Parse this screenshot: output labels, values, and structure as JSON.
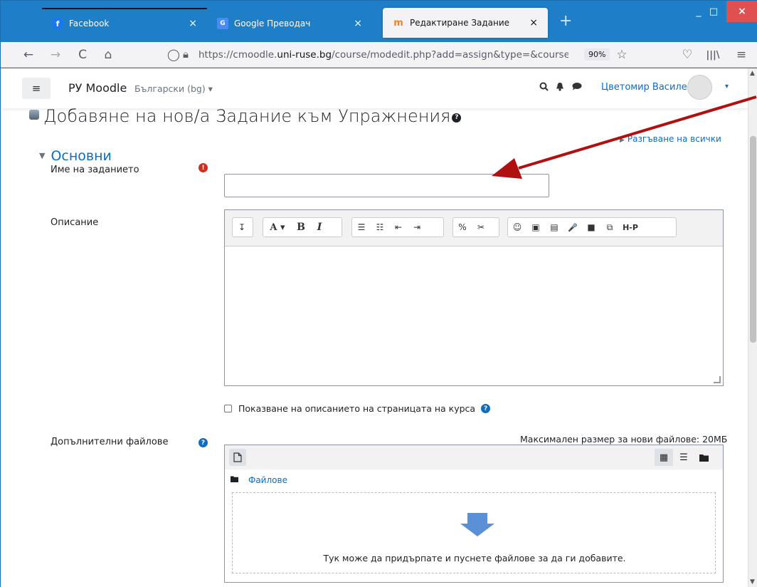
{
  "tabs": [
    {
      "title": "Facebook",
      "icon": "facebook-icon",
      "close": "×"
    },
    {
      "title": "Google Преводач",
      "icon": "google-translate-icon",
      "close": "×"
    },
    {
      "title": "Редактиране Задание",
      "icon": "moodle-icon",
      "close": "×"
    }
  ],
  "newtab": "+",
  "window_controls": {
    "minimize": "_",
    "maximize": "□",
    "close": "×"
  },
  "navbar": {
    "back": "←",
    "forward": "→",
    "reload": "C",
    "home": "⌂",
    "url_prefix": "https://cmoodle.",
    "url_host": "uni-ruse.bg",
    "url_rest": "/course/modedit.php?add=assign&type=&course=",
    "zoom": "90%",
    "star": "☆",
    "pocket": "♡",
    "library": "|||\\",
    "menu": "≡"
  },
  "moodle": {
    "hamburger": "≡",
    "brand": "РУ Moodle",
    "language": "Български (bg) ▾",
    "search_icon": "search-icon",
    "bell_icon": "bell-icon",
    "chat_icon": "chat-icon",
    "username": "Цветомир Василев",
    "user_caret": "▾"
  },
  "page": {
    "title": "Добавяне на нов/а Задание към Упражнения",
    "help": "?",
    "expand_all": "Разгъване на всички",
    "section": "Основни",
    "name_label": "Име на заданието",
    "name_required": "!",
    "name_value": "",
    "description_label": "Описание",
    "show_description": "Показване на описанието на страницата на курса",
    "extra_files_label": "Допълнителни файлове",
    "max_size": "Максимален размер за нови файлове: 20МБ",
    "files_folder": "Файлове",
    "drop_text": "Тук може да придърпате и пуснете файлове за да ги добавите."
  },
  "toolbar": {
    "collapse": "↧",
    "font_color": "A ▾",
    "bold": "B",
    "italic": "I",
    "ul": "☰",
    "ol": "☷",
    "outdent": "⇤",
    "indent": "⇥",
    "link": "%",
    "unlink": "✂",
    "emoji": "☺",
    "image": "▣",
    "media": "▤",
    "record_audio": "🎤",
    "record_video": "■",
    "manage_files": "⧉",
    "h5p": "H-P"
  },
  "colors": {
    "accent": "#0f6cbf",
    "required": "#ca3120",
    "arrow": "#b01010",
    "titlebar": "#1e7ec8"
  }
}
